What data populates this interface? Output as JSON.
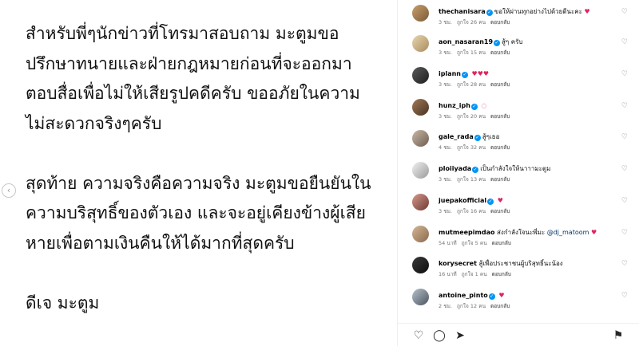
{
  "post": {
    "text": "สำหรับพี่ๆนักข่าวที่โทรมาสอบถาม มะตูมขอ\nปรึกษาทนายและฝ่ายกฎหมายก่อนที่จะออกมา\nตอบสื่อเพื่อไม่ให้เสียรูปคดีครับ ขออภัยในความ\nไม่สะดวกจริงๆครับ\n\nสุดท้าย ความจริงคือความจริง มะตูมขอยืนยันใน\nความบริสุทธิ์ของตัวเอง และจะอยู่เคียงข้างผู้เสีย\nหายเพื่อตามเงินคืนให้ได้มากที่สุดครับ\n\nดีเจ มะตูม",
    "prev_arrow": "‹"
  },
  "comments": [
    {
      "username": "thechanisara",
      "verified": true,
      "text": "ขอให้ผ่านทุกอย่างไปด้วยดีนะคะ",
      "mention": "",
      "emoji": "♥",
      "time": "3 ชม.",
      "likes": "ถูกใจ 26 คน",
      "reply": "ตอบกลับ",
      "avatar": "gold"
    },
    {
      "username": "aon_nasaran19",
      "verified": true,
      "text": "สู้ๆ ครับ",
      "mention": "",
      "emoji": "",
      "time": "3 ชม.",
      "likes": "ถูกใจ 15 คน",
      "reply": "ตอบกลับ",
      "avatar": "blonde"
    },
    {
      "username": "iplann",
      "verified": true,
      "text": "",
      "mention": "",
      "emoji": "♥♥♥",
      "time": "3 ชม.",
      "likes": "ถูกใจ 28 คน",
      "reply": "ตอบกลับ",
      "avatar": "dark"
    },
    {
      "username": "hunz_iph",
      "verified": true,
      "text": "",
      "mention": "",
      "emoji": "◌",
      "time": "3 ชม.",
      "likes": "ถูกใจ 20 คน",
      "reply": "ตอบกลับ",
      "avatar": "brown"
    },
    {
      "username": "gale_rada",
      "verified": true,
      "text": "สู้ๆเธอ",
      "mention": "",
      "emoji": "",
      "time": "4 ชม.",
      "likes": "ถูกใจ 32 คน",
      "reply": "ตอบกลับ",
      "avatar": "group"
    },
    {
      "username": "ploiiyada",
      "verified": true,
      "text": "เป็นกำลังใจให้นาาามะตูม",
      "mention": "",
      "emoji": "",
      "time": "3 ชม.",
      "likes": "ถูกใจ 13 คน",
      "reply": "ตอบกลับ",
      "avatar": "white"
    },
    {
      "username": "juepakofficial",
      "verified": true,
      "text": "",
      "mention": "",
      "emoji": "♥",
      "time": "3 ชม.",
      "likes": "ถูกใจ 16 คน",
      "reply": "ตอบกลับ",
      "avatar": "rose"
    },
    {
      "username": "mutmeepimdao",
      "verified": false,
      "text": "ส่งกำลังใจนะพี่มะ",
      "mention": "@dj_matoom",
      "emoji": "♥",
      "time": "54 นาที",
      "likes": "ถูกใจ 5 คน",
      "reply": "ตอบกลับ",
      "avatar": "tan"
    },
    {
      "username": "korysecret",
      "verified": false,
      "text": "สู้เพื่อประชาชนผู้บริสุทธิ์นะน้อง",
      "mention": "",
      "emoji": "",
      "time": "16 นาที",
      "likes": "ถูกใจ 1 คน",
      "reply": "ตอบกลับ",
      "avatar": "black"
    },
    {
      "username": "antoine_pinto",
      "verified": true,
      "text": "",
      "mention": "",
      "emoji": "♥",
      "time": "2 ชม.",
      "likes": "ถูกใจ 12 คน",
      "reply": "ตอบกลับ",
      "avatar": "blue"
    }
  ],
  "icons": {
    "like": "♡",
    "comment": "◯",
    "share": "➤",
    "save": "⚑",
    "verified": "✓"
  }
}
